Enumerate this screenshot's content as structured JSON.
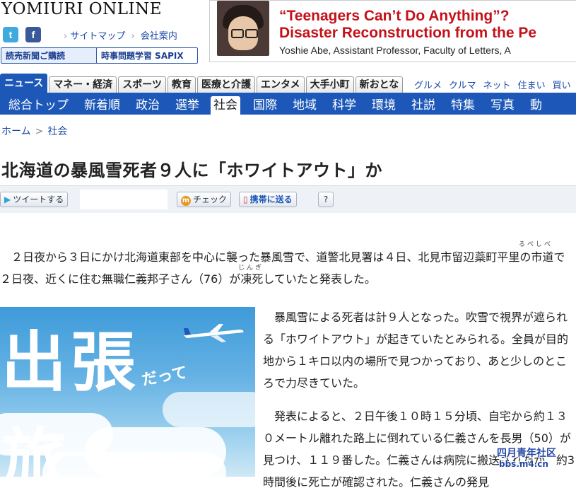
{
  "header": {
    "logo": "YOMIURI ONLINE",
    "sitemap_link": "サイトマップ",
    "company_link": "会社案内",
    "subscribe_button": "読売新聞ご購読",
    "sapix_button": "時事問題学習 SAPIX"
  },
  "ad_banner": {
    "line1": "“Teenagers Can’t Do Anything”?",
    "line2": "Disaster Reconstruction from the Pe",
    "line3": "Yoshie Abe, Assistant Professor, Faculty of Letters, A"
  },
  "nav": {
    "tabs": [
      {
        "label": "ニュース",
        "active": true
      },
      {
        "label": "マネー・経済",
        "active": false
      },
      {
        "label": "スポーツ",
        "active": false
      },
      {
        "label": "教育",
        "active": false
      },
      {
        "label": "医療と介護",
        "active": false
      },
      {
        "label": "エンタメ",
        "active": false
      },
      {
        "label": "大手小町",
        "active": false
      },
      {
        "label": "新おとな",
        "active": false
      }
    ],
    "links": [
      "グルメ",
      "クルマ",
      "ネット",
      "住まい",
      "買い"
    ],
    "subnav": [
      "総合トップ",
      "新着順",
      "政治",
      "選挙",
      "社会",
      "国際",
      "地域",
      "科学",
      "環境",
      "社説",
      "特集",
      "写真",
      "動"
    ],
    "subnav_active": "社会"
  },
  "breadcrumb": {
    "home": "ホーム",
    "current": "社会"
  },
  "article": {
    "headline": "北海道の暴風雪死者９人に「ホワイトアウト」か",
    "tools": {
      "tweet": "ツイートする",
      "check": "チェック",
      "mobile": "携帯に送る",
      "help": "?"
    },
    "ruby1": "るべしべ",
    "ruby2": "じんぎ",
    "para1": "　２日夜から３日にかけ北海道東部を中心に襲った暴風雪で、道警北見署は４日、北見市留辺蘂町平里の市道で２日夜、近くに住む無職仁義邦子さん（76）が凍死していたと発表した。",
    "para2": "　暴風雪による死者は計９人となった。吹雪で視界が遮られる「ホワイトアウト」が起きていたとみられる。全員が目的地から１キロ以内の場所で見つかっており、あと少しのところで力尽きていた。",
    "para3": "　発表によると、２日午後１０時１５分頃、自宅から約１３０メートル離れた路上に倒れている仁義さんを長男（50）が見つけ、１１９番した。仁義さんは病院に搬送されたが、約3時間後に死亡が確認された。仁義さんの発見"
  },
  "travel_ad": {
    "char1": "出",
    "char2": "張",
    "char3": "旅",
    "small": "だって"
  },
  "watermark": {
    "line1": "四月青年社区",
    "line2": "bbs.m4.cn"
  }
}
